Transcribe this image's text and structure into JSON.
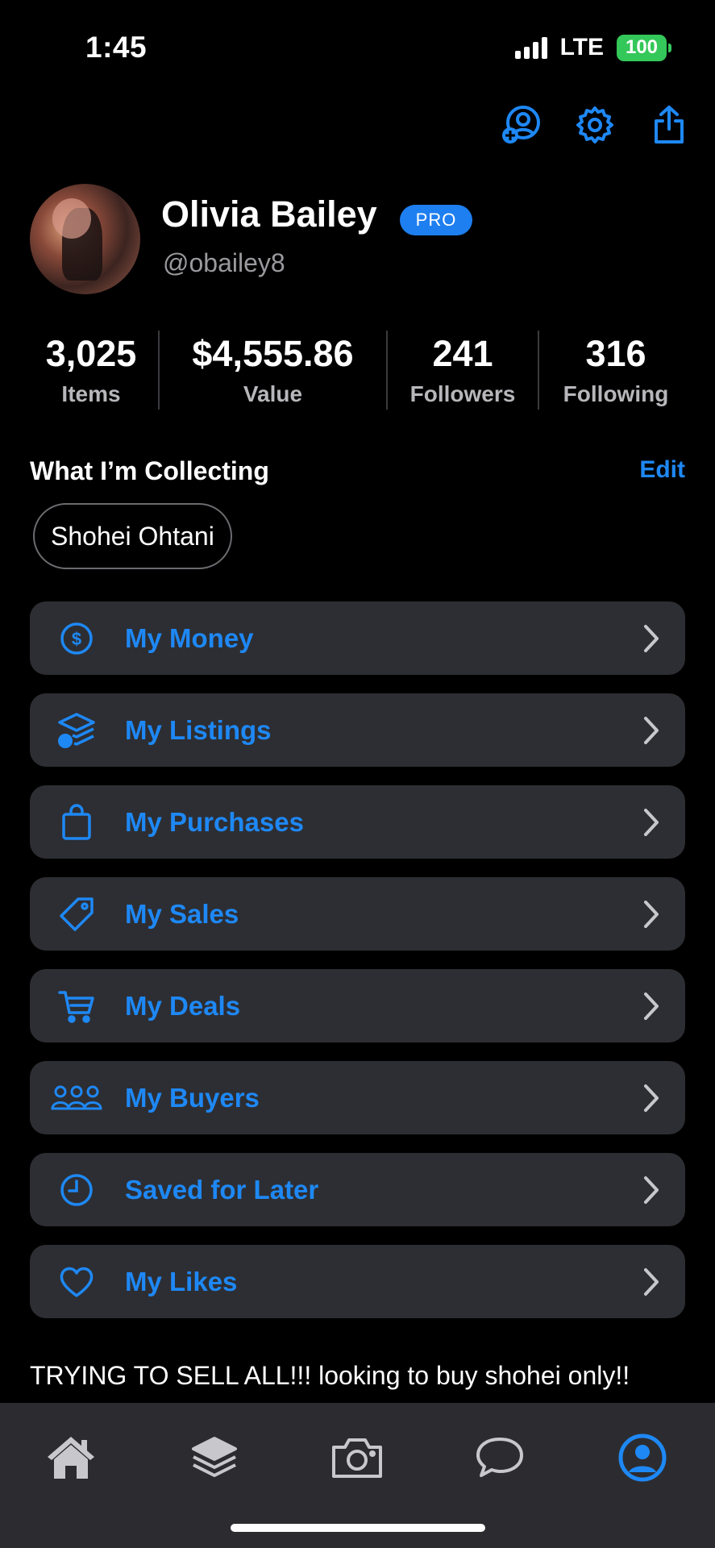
{
  "status_bar": {
    "time": "1:45",
    "network": "LTE",
    "battery": "100"
  },
  "profile": {
    "name": "Olivia Bailey",
    "badge": "PRO",
    "handle": "@obailey8"
  },
  "stats": [
    {
      "value": "3,025",
      "label": "Items"
    },
    {
      "value": "$4,555.86",
      "label": "Value"
    },
    {
      "value": "241",
      "label": "Followers"
    },
    {
      "value": "316",
      "label": "Following"
    }
  ],
  "collecting": {
    "title": "What I’m Collecting",
    "edit_label": "Edit",
    "chips": [
      "Shohei Ohtani"
    ]
  },
  "menu": [
    {
      "label": "My Money",
      "icon": "dollar-circle-icon"
    },
    {
      "label": "My Listings",
      "icon": "stack-dollar-icon"
    },
    {
      "label": "My Purchases",
      "icon": "shopping-bag-icon"
    },
    {
      "label": "My Sales",
      "icon": "tag-icon"
    },
    {
      "label": "My Deals",
      "icon": "cart-icon"
    },
    {
      "label": "My Buyers",
      "icon": "people-icon"
    },
    {
      "label": "Saved for Later",
      "icon": "clock-icon"
    },
    {
      "label": "My Likes",
      "icon": "heart-icon"
    }
  ],
  "bio": "TRYING TO SELL ALL!!! looking to buy shohei only!!",
  "tabs": [
    {
      "icon": "home-icon",
      "active": false
    },
    {
      "icon": "layers-icon",
      "active": false
    },
    {
      "icon": "camera-icon",
      "active": false
    },
    {
      "icon": "chat-icon",
      "active": false
    },
    {
      "icon": "profile-icon",
      "active": true
    }
  ],
  "colors": {
    "accent": "#1e88f5",
    "card": "#2d2e33",
    "background": "#000000",
    "tabbar": "#2c2c30",
    "battery": "#34c759"
  }
}
